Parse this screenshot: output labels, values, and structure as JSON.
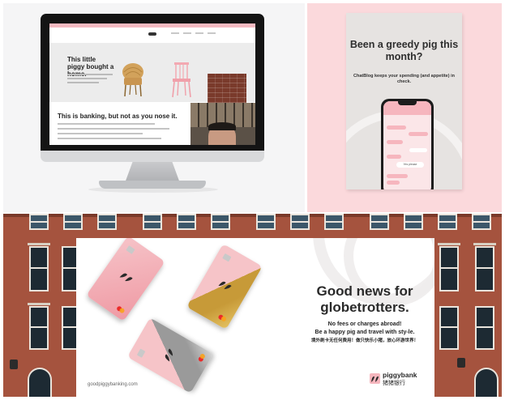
{
  "monitor_mock": {
    "hero_title": "This little piggy bought a home.",
    "section_title": "This is banking, but not as you nose it."
  },
  "poster": {
    "headline": "Been a greedy pig this month?",
    "subline": "ChatBlog keeps your spending (and appetite) in check.",
    "chat_reply": "Yes please"
  },
  "billboard": {
    "headline": "Good news for globetrotters.",
    "subline_lines": [
      "No fees or charges abroad!",
      "Be a happy pig and travel with sty-le.",
      "境外刷卡无任何费用！做只快乐小猪，放心环游世界！"
    ],
    "url": "goodpiggybanking.com",
    "brand_en": "piggybank",
    "brand_zh": "猪猪银行"
  },
  "colors": {
    "brand_pink": "#f6b6be",
    "poster_bg": "#fbd9dc",
    "brick": "#a5533e",
    "gold_card": "#c79a38",
    "silver_card": "#9a9a9a"
  },
  "icons": [
    "pig-logo-icon",
    "mastercard-icon",
    "card-chip-icon"
  ]
}
